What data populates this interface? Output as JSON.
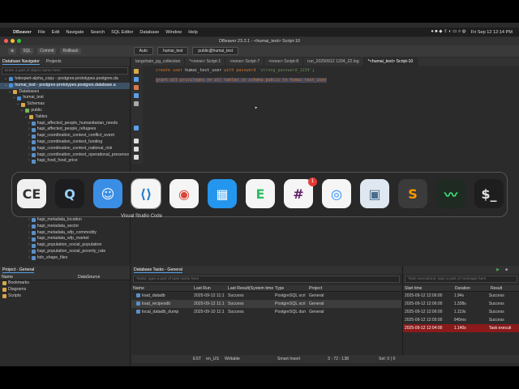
{
  "menubar": {
    "app": "DBeaver",
    "items": [
      "File",
      "Edit",
      "Navigate",
      "Search",
      "SQL Editor",
      "Database",
      "Window",
      "Help"
    ],
    "clock": "Fri Sep 12  12:14 PM"
  },
  "window": {
    "title": "DBeaver 23.2.1 - <humai_test> Script-10"
  },
  "toolbar": {
    "sql": "SQL",
    "commit": "Commit",
    "rollback": "Rollback",
    "mode": "Auto",
    "datasource": "humai_test",
    "schema": "public@humai_test"
  },
  "navigator": {
    "tabs": [
      "Database Navigator",
      "Projects"
    ],
    "filter_placeholder": "Enter a part of object name here",
    "rows": [
      {
        "label": "hdexpert-alpha_copy  - postgres-prototypes.postgres.da",
        "indent": 1,
        "color": "#4a90d9",
        "sel": false
      },
      {
        "label": "humai_test  - postgres-prototypes.postgres.database.a",
        "indent": 1,
        "color": "#4a90d9",
        "sel": true
      },
      {
        "label": "Databases",
        "indent": 2,
        "color": "#d9a84a",
        "sel": false
      },
      {
        "label": "humai_test",
        "indent": 3,
        "color": "#4a90d9",
        "sel": false
      },
      {
        "label": "Schemas",
        "indent": 4,
        "color": "#d9a84a",
        "sel": false
      },
      {
        "label": "public",
        "indent": 5,
        "color": "#7ab55c",
        "sel": false
      },
      {
        "label": "Tables",
        "indent": 6,
        "color": "#d9a84a",
        "sel": false
      },
      {
        "label": "hapi_affected_people_humanitarian_needs",
        "indent": 7,
        "color": "#5b8fc7",
        "sel": false
      },
      {
        "label": "hapi_affected_people_refugees",
        "indent": 7,
        "color": "#5b8fc7",
        "sel": false
      },
      {
        "label": "hapi_coordination_context_conflict_event",
        "indent": 7,
        "color": "#5b8fc7",
        "sel": false
      },
      {
        "label": "hapi_coordination_context_funding",
        "indent": 7,
        "color": "#5b8fc7",
        "sel": false
      },
      {
        "label": "hapi_coordination_context_national_risk",
        "indent": 7,
        "color": "#5b8fc7",
        "sel": false
      },
      {
        "label": "hapi_coordination_context_operational_presence",
        "indent": 7,
        "color": "#5b8fc7",
        "sel": false
      },
      {
        "label": "hapi_food_food_price",
        "indent": 7,
        "color": "#5b8fc7",
        "sel": false
      }
    ],
    "rows_below": [
      {
        "label": "hapi_metadata_location",
        "indent": 7
      },
      {
        "label": "hapi_metadata_sector",
        "indent": 7
      },
      {
        "label": "hapi_metadata_wfp_commodity",
        "indent": 7
      },
      {
        "label": "hapi_metadata_wfp_market",
        "indent": 7
      },
      {
        "label": "hapi_population_social_population",
        "indent": 7
      },
      {
        "label": "hapi_population_social_poverty_rate",
        "indent": 7
      },
      {
        "label": "hdx_shape_files",
        "indent": 7
      }
    ]
  },
  "editor": {
    "tabs": [
      {
        "label": "langchain_pg_collection",
        "active": false
      },
      {
        "label": "*<none> Script-1",
        "active": false
      },
      {
        "label": "<none> Script-7",
        "active": false
      },
      {
        "label": "<none> Script-8",
        "active": false
      },
      {
        "label": "run_20250912 1204_22.log",
        "active": false
      },
      {
        "label": "*<humai_test> Script-10",
        "active": true
      }
    ],
    "line1": {
      "kw": "create user",
      "name": " humai_test_user ",
      "kw2": "with password",
      "str": " 'strong_password_1234'",
      "end": ";"
    },
    "line2": "grant all privileges on all tables in schema public to humai_test_user"
  },
  "dock": {
    "tooltip": "Visual Studio Code",
    "apps": [
      {
        "name": "dbeaver",
        "glyph": "CE",
        "bg": "#f0f0f0",
        "fg": "#333"
      },
      {
        "name": "quicktime",
        "glyph": "Q",
        "bg": "#1d1d1f",
        "fg": "#9bd2ff"
      },
      {
        "name": "finder",
        "glyph": "☺",
        "bg": "#3a8ee6",
        "fg": "#fff"
      },
      {
        "name": "vscode",
        "glyph": "⟨⟩",
        "bg": "#f5f5f5",
        "fg": "#1f7acb"
      },
      {
        "name": "chrome",
        "glyph": "◉",
        "bg": "#f5f5f5",
        "fg": "#db4437"
      },
      {
        "name": "docker",
        "glyph": "▦",
        "bg": "#2496ed",
        "fg": "#fff"
      },
      {
        "name": "evernote",
        "glyph": "E",
        "bg": "#f5f5f5",
        "fg": "#2dbe60"
      },
      {
        "name": "slack",
        "glyph": "#",
        "bg": "#f5f5f5",
        "fg": "#611f69"
      },
      {
        "name": "safari",
        "glyph": "◎",
        "bg": "#f5f5f5",
        "fg": "#1a8cff"
      },
      {
        "name": "preview",
        "glyph": "▣",
        "bg": "#dfe8f0",
        "fg": "#4a6d8c"
      },
      {
        "name": "sublime",
        "glyph": "S",
        "bg": "#3b3b3b",
        "fg": "#ff9800"
      },
      {
        "name": "activity-monitor",
        "glyph": "〰",
        "bg": "#1e2a22",
        "fg": "#3ee27a"
      },
      {
        "name": "terminal",
        "glyph": "$_",
        "bg": "#1e1e1e",
        "fg": "#e0e0e0"
      }
    ],
    "slack_badge": "1"
  },
  "project": {
    "tab": "Project - General",
    "headers": [
      "Name",
      "DataSource"
    ],
    "items": [
      "Bookmarks",
      "Diagrams",
      "Scripts"
    ]
  },
  "tasks": {
    "tab": "Database Tasks - General",
    "filter_placeholder": "Tasks: type a part of task name here",
    "headers": [
      "Name",
      "Last Run",
      "Last Result(System time)",
      "Type",
      "Project"
    ],
    "rows": [
      {
        "name": "load_datadb",
        "last_run": "2025-09-12 11:1",
        "result": "Success",
        "type": "PostgreSQL scri",
        "project": "General",
        "sel": false
      },
      {
        "name": "load_recipesdb",
        "last_run": "2025-09-12 11:1",
        "result": "Success",
        "type": "PostgreSQL scri",
        "project": "General",
        "sel": true
      },
      {
        "name": "local_datadb_dump",
        "last_run": "2025-09-10 11:1",
        "result": "Success",
        "type": "PostgreSQL dun",
        "project": "General",
        "sel": false
      }
    ]
  },
  "executions": {
    "filter_placeholder": "Task executions: type a part of message here",
    "headers": [
      "Start time",
      "Duration",
      "Result"
    ],
    "rows": [
      {
        "start": "2025-09-12 12:06:00",
        "duration": "1.94s",
        "result": "Success",
        "err": false
      },
      {
        "start": "2025-09-12 12:06:00",
        "duration": "1.338s",
        "result": "Success",
        "err": false
      },
      {
        "start": "2025-09-12 12:06:00",
        "duration": "1.119s",
        "result": "Success",
        "err": false
      },
      {
        "start": "2025-09-12 12:05:00",
        "duration": "945ms",
        "result": "Success",
        "err": false
      },
      {
        "start": "2025-09-12 12:04:00",
        "duration": "1.140s",
        "result": "Task executi",
        "err": true
      }
    ]
  },
  "status": {
    "tz": "EST",
    "locale": "en_US",
    "mode": "Writable",
    "insert": "Smart Insert",
    "pos": "3 : 72 : 138",
    "sel": "Sel: 0 | 0"
  }
}
